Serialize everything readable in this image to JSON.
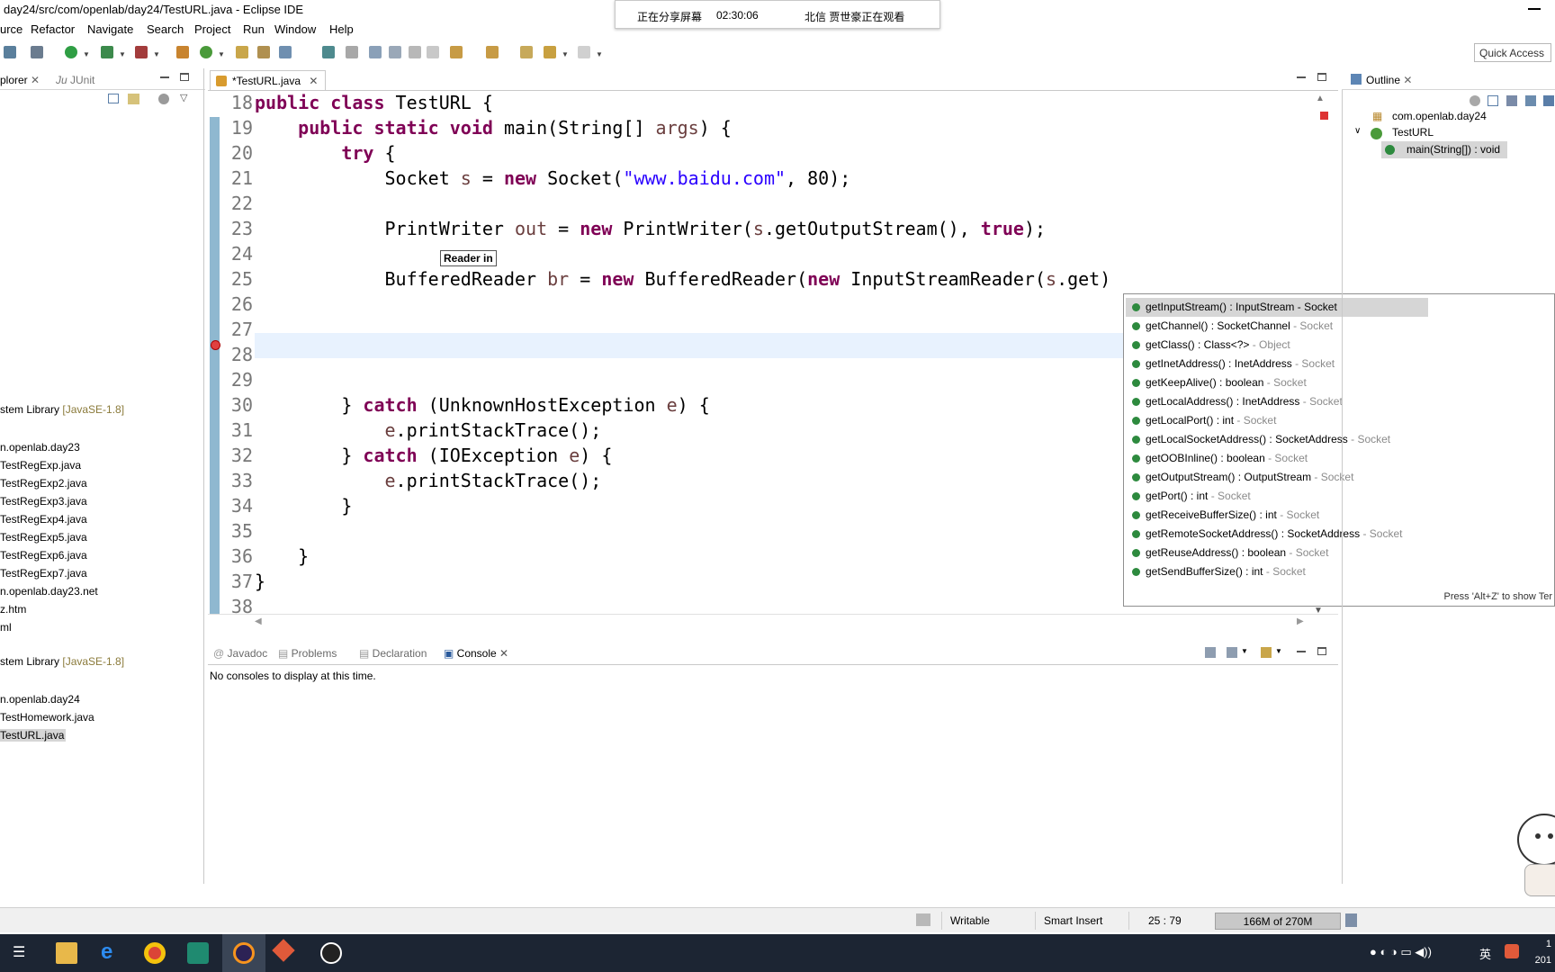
{
  "window": {
    "title": "day24/src/com/openlab/day24/TestURL.java - Eclipse IDE"
  },
  "share_banner": {
    "status": "正在分享屏幕",
    "time": "02:30:06",
    "viewer": "北信 贾世豪正在观看"
  },
  "menu": [
    "urce",
    "Refactor",
    "Navigate",
    "Search",
    "Project",
    "Run",
    "Window",
    "Help"
  ],
  "quick_access": "Quick Access",
  "explorer": {
    "tabs": [
      "plorer",
      "JUnit"
    ],
    "items": [
      {
        "label": "stem Library ",
        "jre": "[JavaSE-1.8]"
      },
      {
        "label": "n.openlab.day23",
        "jre": ""
      },
      {
        "label": "TestRegExp.java",
        "jre": ""
      },
      {
        "label": "TestRegExp2.java",
        "jre": ""
      },
      {
        "label": "TestRegExp3.java",
        "jre": ""
      },
      {
        "label": "TestRegExp4.java",
        "jre": ""
      },
      {
        "label": "TestRegExp5.java",
        "jre": ""
      },
      {
        "label": "TestRegExp6.java",
        "jre": ""
      },
      {
        "label": "TestRegExp7.java",
        "jre": ""
      },
      {
        "label": "n.openlab.day23.net",
        "jre": ""
      },
      {
        "label": "z.htm",
        "jre": ""
      },
      {
        "label": "ml",
        "jre": ""
      },
      {
        "label": "stem Library ",
        "jre": "[JavaSE-1.8]"
      },
      {
        "label": "n.openlab.day24",
        "jre": ""
      },
      {
        "label": "TestHomework.java",
        "jre": ""
      },
      {
        "label": "TestURL.java",
        "jre": ""
      }
    ]
  },
  "editor": {
    "tab": "*TestURL.java",
    "lines": [
      {
        "n": "18",
        "tokens": [
          {
            "t": "public class ",
            "k": "kw"
          },
          {
            "t": "TestURL {",
            "k": ""
          }
        ]
      },
      {
        "n": "19",
        "tokens": [
          {
            "t": "    ",
            "k": ""
          },
          {
            "t": "public static void ",
            "k": "kw"
          },
          {
            "t": "main(String[] ",
            "k": ""
          },
          {
            "t": "args",
            "k": "var"
          },
          {
            "t": ") {",
            "k": ""
          }
        ]
      },
      {
        "n": "20",
        "tokens": [
          {
            "t": "        ",
            "k": ""
          },
          {
            "t": "try",
            "k": "kw"
          },
          {
            "t": " {",
            "k": ""
          }
        ]
      },
      {
        "n": "21",
        "tokens": [
          {
            "t": "            Socket ",
            "k": ""
          },
          {
            "t": "s",
            "k": "var"
          },
          {
            "t": " = ",
            "k": ""
          },
          {
            "t": "new",
            "k": "kw"
          },
          {
            "t": " Socket(",
            "k": ""
          },
          {
            "t": "\"www.baidu.com\"",
            "k": "str"
          },
          {
            "t": ", 80);",
            "k": ""
          }
        ]
      },
      {
        "n": "22",
        "tokens": []
      },
      {
        "n": "23",
        "tokens": [
          {
            "t": "            PrintWriter ",
            "k": ""
          },
          {
            "t": "out",
            "k": "var"
          },
          {
            "t": " = ",
            "k": ""
          },
          {
            "t": "new",
            "k": "kw"
          },
          {
            "t": " PrintWriter(",
            "k": ""
          },
          {
            "t": "s",
            "k": "var"
          },
          {
            "t": ".getOutputStream(), ",
            "k": ""
          },
          {
            "t": "true",
            "k": "kw"
          },
          {
            "t": ");",
            "k": ""
          }
        ]
      },
      {
        "n": "24",
        "tokens": []
      },
      {
        "n": "25",
        "tokens": [
          {
            "t": "            BufferedReader ",
            "k": ""
          },
          {
            "t": "br",
            "k": "var"
          },
          {
            "t": " = ",
            "k": ""
          },
          {
            "t": "new",
            "k": "kw"
          },
          {
            "t": " BufferedReader(",
            "k": ""
          },
          {
            "t": "new",
            "k": "kw"
          },
          {
            "t": " InputStreamReader(",
            "k": ""
          },
          {
            "t": "s",
            "k": "var"
          },
          {
            "t": ".get)",
            "k": ""
          }
        ]
      },
      {
        "n": "26",
        "tokens": []
      },
      {
        "n": "27",
        "tokens": []
      },
      {
        "n": "28",
        "tokens": []
      },
      {
        "n": "29",
        "tokens": []
      },
      {
        "n": "30",
        "tokens": [
          {
            "t": "        } ",
            "k": ""
          },
          {
            "t": "catch",
            "k": "kw"
          },
          {
            "t": " (UnknownHostException ",
            "k": ""
          },
          {
            "t": "e",
            "k": "var"
          },
          {
            "t": ") {",
            "k": ""
          }
        ]
      },
      {
        "n": "31",
        "tokens": [
          {
            "t": "            ",
            "k": ""
          },
          {
            "t": "e",
            "k": "var"
          },
          {
            "t": ".printStackTrace();",
            "k": ""
          }
        ]
      },
      {
        "n": "32",
        "tokens": [
          {
            "t": "        } ",
            "k": ""
          },
          {
            "t": "catch",
            "k": "kw"
          },
          {
            "t": " (IOException ",
            "k": ""
          },
          {
            "t": "e",
            "k": "var"
          },
          {
            "t": ") {",
            "k": ""
          }
        ]
      },
      {
        "n": "33",
        "tokens": [
          {
            "t": "            ",
            "k": ""
          },
          {
            "t": "e",
            "k": "var"
          },
          {
            "t": ".printStackTrace();",
            "k": ""
          }
        ]
      },
      {
        "n": "34",
        "tokens": [
          {
            "t": "        }",
            "k": ""
          }
        ]
      },
      {
        "n": "35",
        "tokens": []
      },
      {
        "n": "36",
        "tokens": [
          {
            "t": "    }",
            "k": ""
          }
        ]
      },
      {
        "n": "37",
        "tokens": [
          {
            "t": "}",
            "k": ""
          }
        ]
      },
      {
        "n": "38",
        "tokens": []
      }
    ]
  },
  "tooltip": "Reader in",
  "completion": {
    "items": [
      {
        "name": "getInputStream() : InputStream",
        "owner": " - Socket",
        "selected": true
      },
      {
        "name": "getChannel() : SocketChannel",
        "owner": " - Socket",
        "selected": false
      },
      {
        "name": "getClass() : Class<?>",
        "owner": " - Object",
        "selected": false
      },
      {
        "name": "getInetAddress() : InetAddress",
        "owner": " - Socket",
        "selected": false
      },
      {
        "name": "getKeepAlive() : boolean",
        "owner": " - Socket",
        "selected": false
      },
      {
        "name": "getLocalAddress() : InetAddress",
        "owner": " - Socket",
        "selected": false
      },
      {
        "name": "getLocalPort() : int",
        "owner": " - Socket",
        "selected": false
      },
      {
        "name": "getLocalSocketAddress() : SocketAddress",
        "owner": " - Socket",
        "selected": false
      },
      {
        "name": "getOOBInline() : boolean",
        "owner": " - Socket",
        "selected": false
      },
      {
        "name": "getOutputStream() : OutputStream",
        "owner": " - Socket",
        "selected": false
      },
      {
        "name": "getPort() : int",
        "owner": " - Socket",
        "selected": false
      },
      {
        "name": "getReceiveBufferSize() : int",
        "owner": " - Socket",
        "selected": false
      },
      {
        "name": "getRemoteSocketAddress() : SocketAddress",
        "owner": " - Socket",
        "selected": false
      },
      {
        "name": "getReuseAddress() : boolean",
        "owner": " - Socket",
        "selected": false
      },
      {
        "name": "getSendBufferSize() : int",
        "owner": " - Socket",
        "selected": false
      }
    ],
    "footer": "Press 'Alt+Z' to show Ter"
  },
  "outline": {
    "tab": "Outline",
    "package": "com.openlab.day24",
    "class": "TestURL",
    "method": "main(String[]) : void"
  },
  "console": {
    "tabs": [
      "Javadoc",
      "Problems",
      "Declaration",
      "Console"
    ],
    "message": "No consoles to display at this time."
  },
  "status": {
    "writable": "Writable",
    "insert_mode": "Smart Insert",
    "position": "25 : 79",
    "heap": "166M of 270M"
  },
  "taskbar": {
    "clock_top": "1",
    "clock_bottom": "201",
    "ime": "英"
  }
}
